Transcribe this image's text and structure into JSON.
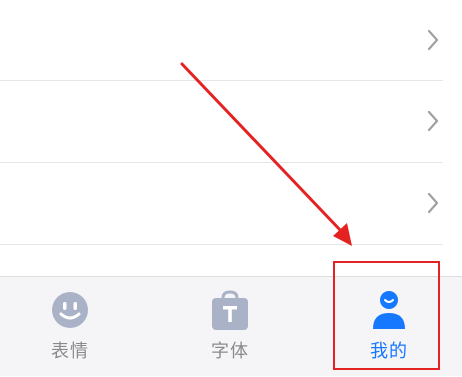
{
  "list": {
    "rows": [
      {
        "chevron": "chevron-right-icon"
      },
      {
        "chevron": "chevron-right-icon"
      },
      {
        "chevron": "chevron-right-icon"
      }
    ]
  },
  "tabbar": {
    "tabs": [
      {
        "label": "表情",
        "icon": "smiley-face-icon",
        "active": false
      },
      {
        "label": "字体",
        "icon": "shopping-bag-t-icon",
        "active": false
      },
      {
        "label": "我的",
        "icon": "user-profile-icon",
        "active": true
      }
    ]
  },
  "annotation": {
    "arrow_color": "#e52222",
    "highlight_color": "#e52222"
  },
  "colors": {
    "active": "#1677ff",
    "inactive_icon": "#a9b2c6",
    "inactive_text": "#8a8a8a"
  }
}
